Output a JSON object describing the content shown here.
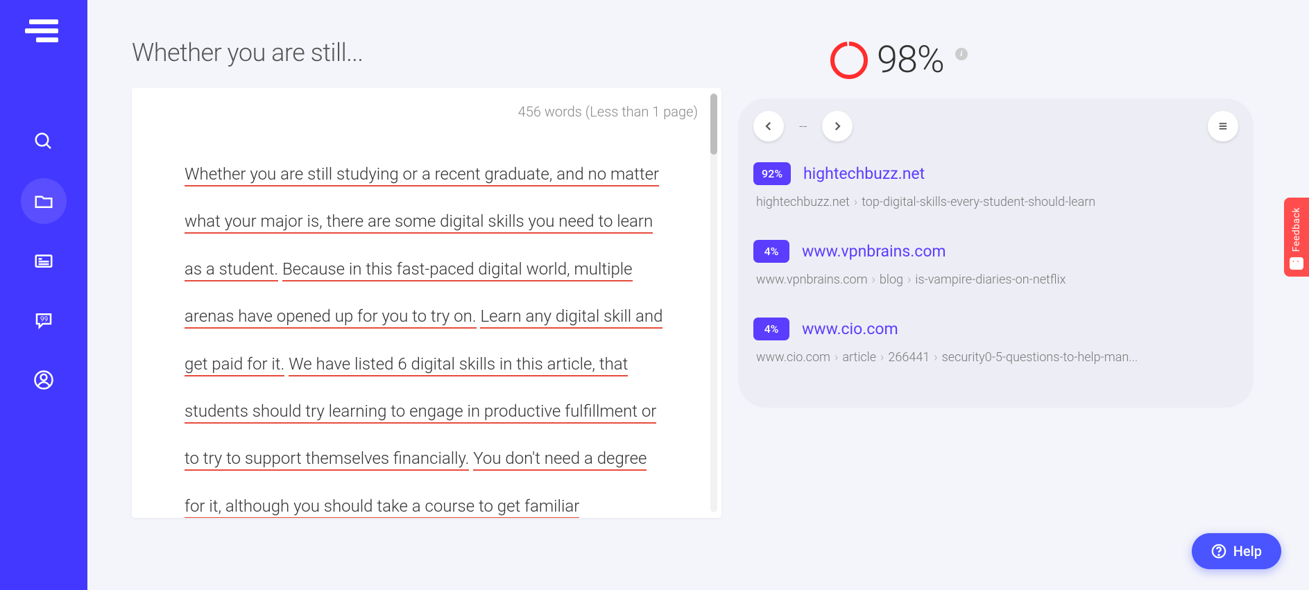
{
  "title": "Whether you are still...",
  "word_count": "456 words (Less than 1 page)",
  "editor_text": "Whether you are still studying or a recent graduate, and no matter what your major is, there are some digital skills you need to learn as a student. Because in this fast-paced digital world, multiple arenas have opened up for you to try on. Learn any digital skill and get paid for it. We have listed 6 digital skills in this article, that students should try learning to engage in productive fulfillment or to try to support themselves financially. You don't need a degree for it, although you should take a course to get familiar",
  "score_pct": "98%",
  "score_ring_value": 98,
  "pager": "--",
  "results": [
    {
      "pct": "92%",
      "domain": "hightechbuzz.net",
      "path": [
        "hightechbuzz.net",
        "top-digital-skills-every-student-should-learn"
      ]
    },
    {
      "pct": "4%",
      "domain": "www.vpnbrains.com",
      "path": [
        "www.vpnbrains.com",
        "blog",
        "is-vampire-diaries-on-netflix"
      ]
    },
    {
      "pct": "4%",
      "domain": "www.cio.com",
      "path": [
        "www.cio.com",
        "article",
        "266441",
        "security0-5-questions-to-help-man..."
      ]
    }
  ],
  "feedback_label": "Feedback",
  "help_label": "Help"
}
